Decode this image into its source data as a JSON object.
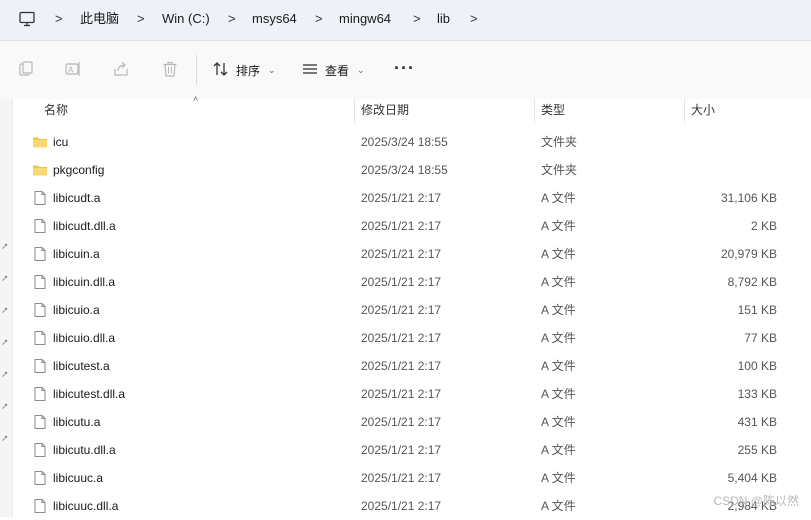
{
  "breadcrumb": {
    "icon": "computer-icon",
    "items": [
      "此电脑",
      "Win (C:)",
      "msys64",
      "mingw64",
      "lib"
    ],
    "separator": ">"
  },
  "toolbar": {
    "icons": [
      "copy-icon",
      "rename-icon",
      "share-icon",
      "delete-icon"
    ],
    "sort_label": "排序",
    "view_label": "查看",
    "more_label": "···"
  },
  "columns": {
    "name": "名称",
    "date": "修改日期",
    "type": "类型",
    "size": "大小"
  },
  "files": [
    {
      "name": "icu",
      "date": "2025/3/24 18:55",
      "type": "文件夹",
      "size": "",
      "kind": "folder"
    },
    {
      "name": "pkgconfig",
      "date": "2025/3/24 18:55",
      "type": "文件夹",
      "size": "",
      "kind": "folder"
    },
    {
      "name": "libicudt.a",
      "date": "2025/1/21 2:17",
      "type": "A 文件",
      "size": "31,106 KB",
      "kind": "file"
    },
    {
      "name": "libicudt.dll.a",
      "date": "2025/1/21 2:17",
      "type": "A 文件",
      "size": "2 KB",
      "kind": "file"
    },
    {
      "name": "libicuin.a",
      "date": "2025/1/21 2:17",
      "type": "A 文件",
      "size": "20,979 KB",
      "kind": "file"
    },
    {
      "name": "libicuin.dll.a",
      "date": "2025/1/21 2:17",
      "type": "A 文件",
      "size": "8,792 KB",
      "kind": "file"
    },
    {
      "name": "libicuio.a",
      "date": "2025/1/21 2:17",
      "type": "A 文件",
      "size": "151 KB",
      "kind": "file"
    },
    {
      "name": "libicuio.dll.a",
      "date": "2025/1/21 2:17",
      "type": "A 文件",
      "size": "77 KB",
      "kind": "file"
    },
    {
      "name": "libicutest.a",
      "date": "2025/1/21 2:17",
      "type": "A 文件",
      "size": "100 KB",
      "kind": "file"
    },
    {
      "name": "libicutest.dll.a",
      "date": "2025/1/21 2:17",
      "type": "A 文件",
      "size": "133 KB",
      "kind": "file"
    },
    {
      "name": "libicutu.a",
      "date": "2025/1/21 2:17",
      "type": "A 文件",
      "size": "431 KB",
      "kind": "file"
    },
    {
      "name": "libicutu.dll.a",
      "date": "2025/1/21 2:17",
      "type": "A 文件",
      "size": "255 KB",
      "kind": "file"
    },
    {
      "name": "libicuuc.a",
      "date": "2025/1/21 2:17",
      "type": "A 文件",
      "size": "5,404 KB",
      "kind": "file"
    },
    {
      "name": "libicuuc.dll.a",
      "date": "2025/1/21 2:17",
      "type": "A 文件",
      "size": "2,984 KB",
      "kind": "file"
    }
  ],
  "colors": {
    "folder": "#f2c14e",
    "address_bar_bg": "#eef2f8"
  },
  "watermark": "CSDN @陈以然"
}
